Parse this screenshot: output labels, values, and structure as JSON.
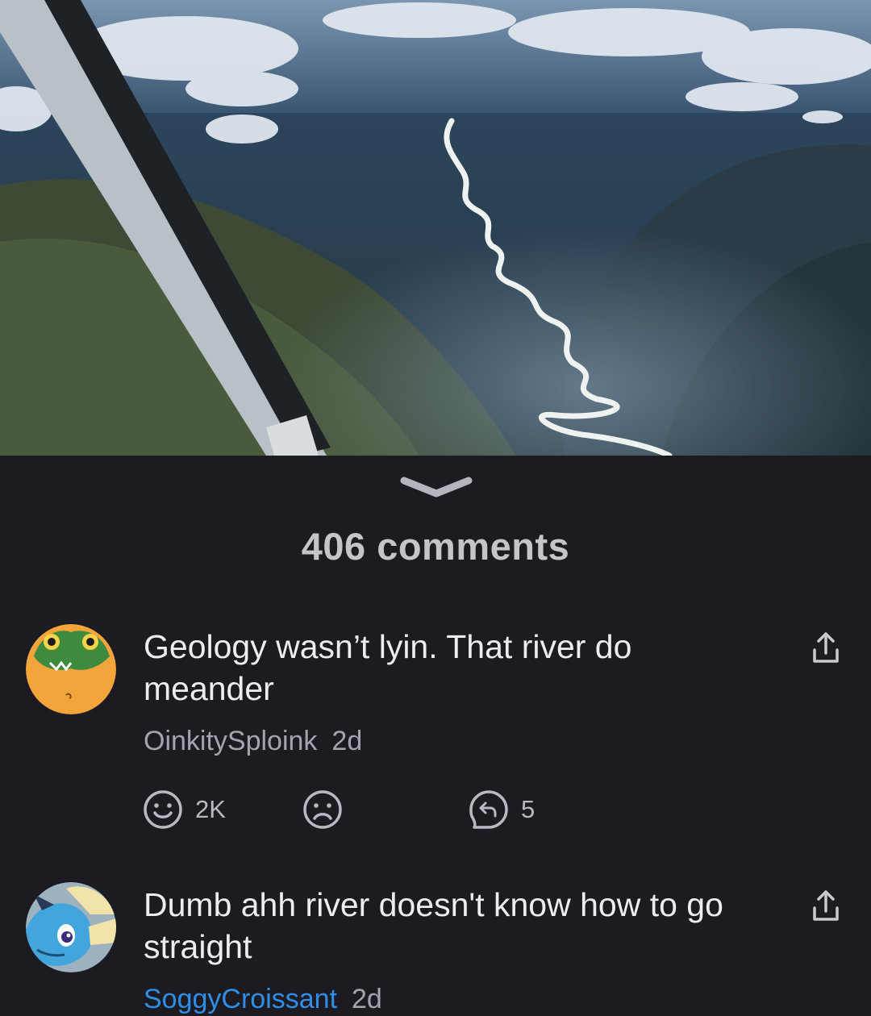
{
  "post": {
    "image_alt": "Aerial view of a meandering river through a forested valley seen past an airplane wing strut"
  },
  "comments_header": {
    "count_label": "406 comments"
  },
  "comments": [
    {
      "text": "Geology wasn’t lyin. That river do meander",
      "username": "OinkitySploink",
      "time": "2d",
      "likes": "2K",
      "replies": "5",
      "username_color": "#a4a4ad"
    },
    {
      "text": "Dumb ahh river doesn't know how to go straight",
      "username": "SoggyCroissant",
      "time": "2d",
      "username_color": "#2f8fe6"
    }
  ],
  "icons": {
    "collapse": "chevron-down-icon",
    "share": "share-icon",
    "like": "smile-icon",
    "dislike": "frown-icon",
    "reply": "reply-icon"
  },
  "colors": {
    "background": "#1c1b22",
    "text_primary": "#ececf1",
    "text_secondary": "#a4a4ad",
    "link_blue": "#2f8fe6"
  }
}
